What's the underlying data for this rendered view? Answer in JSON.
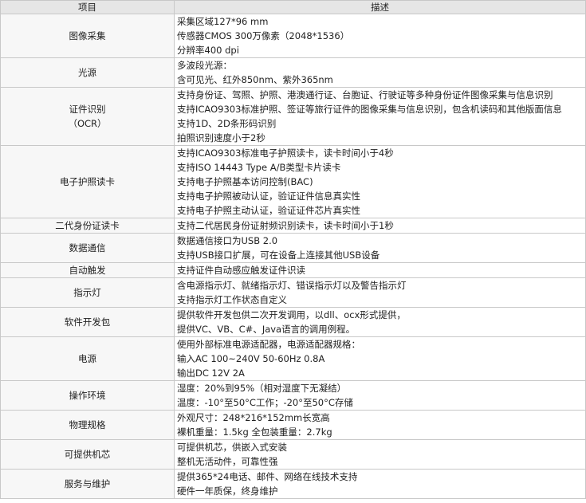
{
  "header": {
    "item": "项目",
    "desc": "描述"
  },
  "rows": [
    {
      "item": [
        "图像采集"
      ],
      "lines": [
        "采集区域127*96 mm",
        "传感器CMOS 300万像素（2048*1536）",
        "分辨率400 dpi"
      ]
    },
    {
      "item": [
        "光源"
      ],
      "lines": [
        "多波段光源：",
        "含可见光、红外850nm、紫外365nm"
      ]
    },
    {
      "item": [
        "证件识别",
        "（OCR）"
      ],
      "lines": [
        "支持身份证、驾照、护照、港澳通行证、台胞证、行驶证等多种身份证件图像采集与信息识别",
        "支持ICAO9303标准护照、签证等旅行证件的图像采集与信息识别，包含机读码和其他版面信息",
        "支持1D、2D条形码识别",
        "拍照识别速度小于2秒"
      ]
    },
    {
      "item": [
        "电子护照读卡"
      ],
      "lines": [
        "支持ICAO9303标准电子护照读卡，读卡时间小于4秒",
        "支持ISO 14443 Type A/B类型卡片读卡",
        "支持电子护照基本访问控制(BAC)",
        "支持电子护照被动认证，验证证件信息真实性",
        "支持电子护照主动认证，验证证件芯片真实性"
      ]
    },
    {
      "item": [
        "二代身份证读卡"
      ],
      "lines": [
        "支持二代居民身份证射频识别读卡，读卡时间小于1秒"
      ]
    },
    {
      "item": [
        "数据通信"
      ],
      "lines": [
        "数据通信接口为USB 2.0",
        "支持USB接口扩展，可在设备上连接其他USB设备"
      ]
    },
    {
      "item": [
        "自动触发"
      ],
      "lines": [
        "支持证件自动感应触发证件识读"
      ]
    },
    {
      "item": [
        "指示灯"
      ],
      "lines": [
        "含电源指示灯、就绪指示灯、错误指示灯以及警告指示灯",
        "支持指示灯工作状态自定义"
      ]
    },
    {
      "item": [
        "软件开发包"
      ],
      "lines": [
        "提供软件开发包供二次开发调用，以dll、ocx形式提供，",
        "提供VC、VB、C#、Java语言的调用例程。"
      ]
    },
    {
      "item": [
        "电源"
      ],
      "lines": [
        "使用外部标准电源适配器，电源适配器规格：",
        "输入AC 100~240V  50-60Hz  0.8A",
        "输出DC 12V  2A"
      ]
    },
    {
      "item": [
        "操作环境"
      ],
      "lines": [
        "湿度：20%到95%（相对湿度下无凝结）",
        "温度：-10°至50°C工作；-20°至50°C存储"
      ]
    },
    {
      "item": [
        "物理规格"
      ],
      "lines": [
        "外观尺寸：248*216*152mm长宽高",
        "裸机重量：1.5kg  全包装重量：2.7kg"
      ]
    },
    {
      "item": [
        "可提供机芯"
      ],
      "lines": [
        "可提供机芯，供嵌入式安装",
        "整机无活动件，可靠性强"
      ]
    },
    {
      "item": [
        "服务与维护"
      ],
      "lines": [
        "提供365*24电话、邮件、网络在线技术支持",
        "硬件一年质保，终身维护"
      ]
    }
  ]
}
